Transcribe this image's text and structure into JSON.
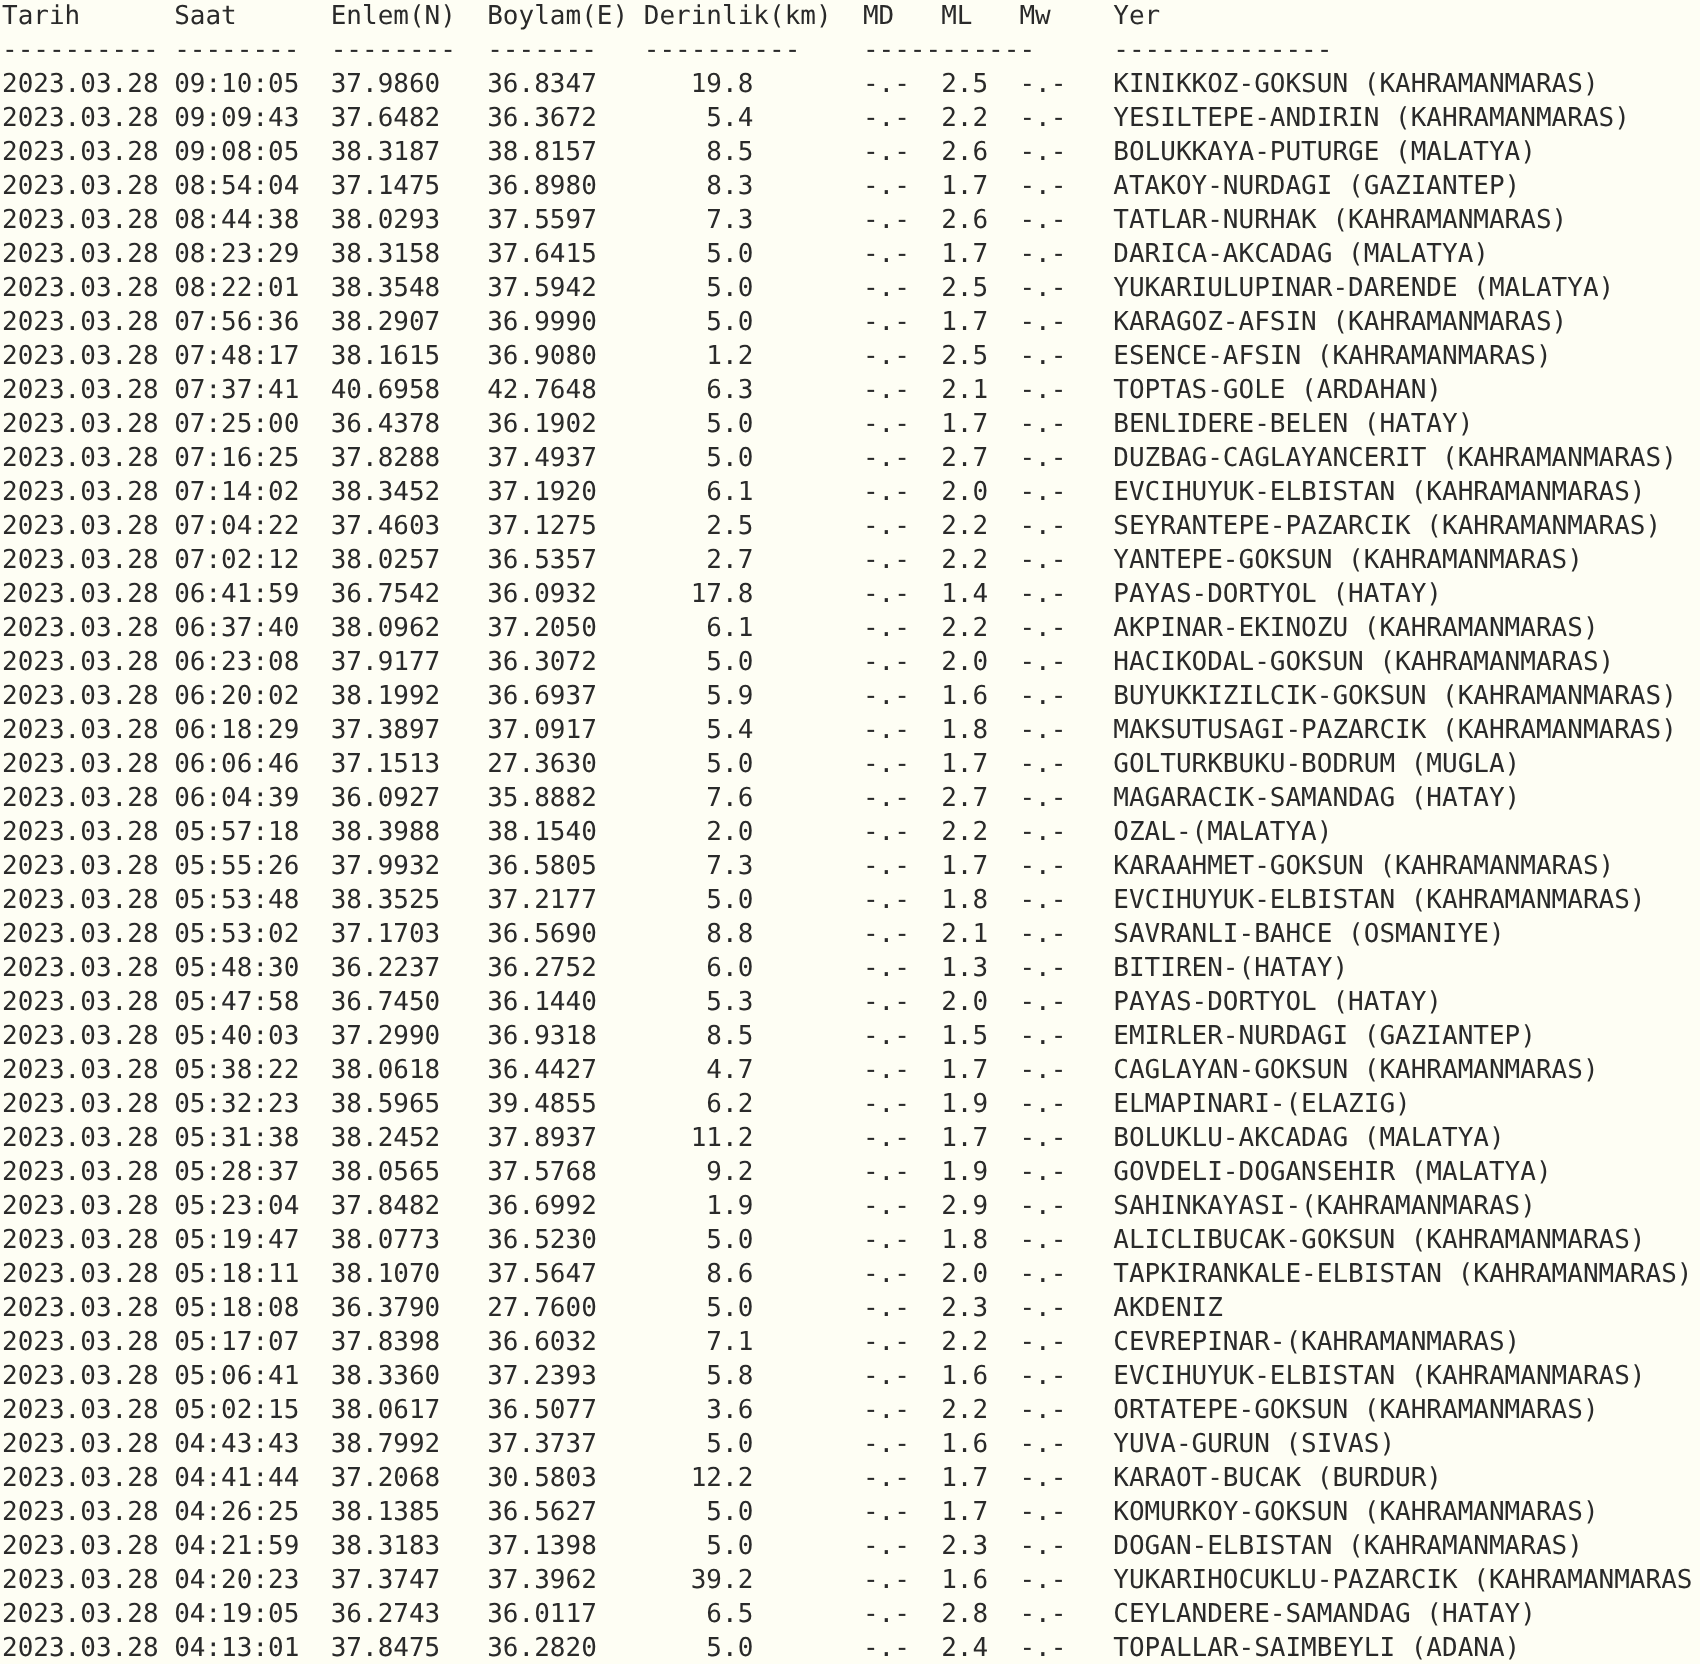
{
  "header": [
    "Tarih",
    "Saat",
    "Enlem(N)",
    "Boylam(E)",
    "Derinlik(km)",
    "MD",
    "ML",
    "Mw",
    "Yer"
  ],
  "rules": [
    "----------",
    "--------",
    "--------",
    "-------",
    "----------",
    "-----------",
    "--------------"
  ],
  "rows": [
    {
      "date": "2023.03.28",
      "time": "09:10:05",
      "lat": "37.9860",
      "lon": "36.8347",
      "depth": "19.8",
      "md": "-.-",
      "ml": "2.5",
      "mw": "-.-",
      "place": "KINIKKOZ-GOKSUN (KAHRAMANMARAS)"
    },
    {
      "date": "2023.03.28",
      "time": "09:09:43",
      "lat": "37.6482",
      "lon": "36.3672",
      "depth": "5.4",
      "md": "-.-",
      "ml": "2.2",
      "mw": "-.-",
      "place": "YESILTEPE-ANDIRIN (KAHRAMANMARAS)"
    },
    {
      "date": "2023.03.28",
      "time": "09:08:05",
      "lat": "38.3187",
      "lon": "38.8157",
      "depth": "8.5",
      "md": "-.-",
      "ml": "2.6",
      "mw": "-.-",
      "place": "BOLUKKAYA-PUTURGE (MALATYA)"
    },
    {
      "date": "2023.03.28",
      "time": "08:54:04",
      "lat": "37.1475",
      "lon": "36.8980",
      "depth": "8.3",
      "md": "-.-",
      "ml": "1.7",
      "mw": "-.-",
      "place": "ATAKOY-NURDAGI (GAZIANTEP)"
    },
    {
      "date": "2023.03.28",
      "time": "08:44:38",
      "lat": "38.0293",
      "lon": "37.5597",
      "depth": "7.3",
      "md": "-.-",
      "ml": "2.6",
      "mw": "-.-",
      "place": "TATLAR-NURHAK (KAHRAMANMARAS)"
    },
    {
      "date": "2023.03.28",
      "time": "08:23:29",
      "lat": "38.3158",
      "lon": "37.6415",
      "depth": "5.0",
      "md": "-.-",
      "ml": "1.7",
      "mw": "-.-",
      "place": "DARICA-AKCADAG (MALATYA)"
    },
    {
      "date": "2023.03.28",
      "time": "08:22:01",
      "lat": "38.3548",
      "lon": "37.5942",
      "depth": "5.0",
      "md": "-.-",
      "ml": "2.5",
      "mw": "-.-",
      "place": "YUKARIULUPINAR-DARENDE (MALATYA)"
    },
    {
      "date": "2023.03.28",
      "time": "07:56:36",
      "lat": "38.2907",
      "lon": "36.9990",
      "depth": "5.0",
      "md": "-.-",
      "ml": "1.7",
      "mw": "-.-",
      "place": "KARAGOZ-AFSIN (KAHRAMANMARAS)"
    },
    {
      "date": "2023.03.28",
      "time": "07:48:17",
      "lat": "38.1615",
      "lon": "36.9080",
      "depth": "1.2",
      "md": "-.-",
      "ml": "2.5",
      "mw": "-.-",
      "place": "ESENCE-AFSIN (KAHRAMANMARAS)"
    },
    {
      "date": "2023.03.28",
      "time": "07:37:41",
      "lat": "40.6958",
      "lon": "42.7648",
      "depth": "6.3",
      "md": "-.-",
      "ml": "2.1",
      "mw": "-.-",
      "place": "TOPTAS-GOLE (ARDAHAN)"
    },
    {
      "date": "2023.03.28",
      "time": "07:25:00",
      "lat": "36.4378",
      "lon": "36.1902",
      "depth": "5.0",
      "md": "-.-",
      "ml": "1.7",
      "mw": "-.-",
      "place": "BENLIDERE-BELEN (HATAY)"
    },
    {
      "date": "2023.03.28",
      "time": "07:16:25",
      "lat": "37.8288",
      "lon": "37.4937",
      "depth": "5.0",
      "md": "-.-",
      "ml": "2.7",
      "mw": "-.-",
      "place": "DUZBAG-CAGLAYANCERIT (KAHRAMANMARAS)"
    },
    {
      "date": "2023.03.28",
      "time": "07:14:02",
      "lat": "38.3452",
      "lon": "37.1920",
      "depth": "6.1",
      "md": "-.-",
      "ml": "2.0",
      "mw": "-.-",
      "place": "EVCIHUYUK-ELBISTAN (KAHRAMANMARAS)"
    },
    {
      "date": "2023.03.28",
      "time": "07:04:22",
      "lat": "37.4603",
      "lon": "37.1275",
      "depth": "2.5",
      "md": "-.-",
      "ml": "2.2",
      "mw": "-.-",
      "place": "SEYRANTEPE-PAZARCIK (KAHRAMANMARAS)"
    },
    {
      "date": "2023.03.28",
      "time": "07:02:12",
      "lat": "38.0257",
      "lon": "36.5357",
      "depth": "2.7",
      "md": "-.-",
      "ml": "2.2",
      "mw": "-.-",
      "place": "YANTEPE-GOKSUN (KAHRAMANMARAS)"
    },
    {
      "date": "2023.03.28",
      "time": "06:41:59",
      "lat": "36.7542",
      "lon": "36.0932",
      "depth": "17.8",
      "md": "-.-",
      "ml": "1.4",
      "mw": "-.-",
      "place": "PAYAS-DORTYOL (HATAY)"
    },
    {
      "date": "2023.03.28",
      "time": "06:37:40",
      "lat": "38.0962",
      "lon": "37.2050",
      "depth": "6.1",
      "md": "-.-",
      "ml": "2.2",
      "mw": "-.-",
      "place": "AKPINAR-EKINOZU (KAHRAMANMARAS)"
    },
    {
      "date": "2023.03.28",
      "time": "06:23:08",
      "lat": "37.9177",
      "lon": "36.3072",
      "depth": "5.0",
      "md": "-.-",
      "ml": "2.0",
      "mw": "-.-",
      "place": "HACIKODAL-GOKSUN (KAHRAMANMARAS)"
    },
    {
      "date": "2023.03.28",
      "time": "06:20:02",
      "lat": "38.1992",
      "lon": "36.6937",
      "depth": "5.9",
      "md": "-.-",
      "ml": "1.6",
      "mw": "-.-",
      "place": "BUYUKKIZILCIK-GOKSUN (KAHRAMANMARAS)"
    },
    {
      "date": "2023.03.28",
      "time": "06:18:29",
      "lat": "37.3897",
      "lon": "37.0917",
      "depth": "5.4",
      "md": "-.-",
      "ml": "1.8",
      "mw": "-.-",
      "place": "MAKSUTUSAGI-PAZARCIK (KAHRAMANMARAS)"
    },
    {
      "date": "2023.03.28",
      "time": "06:06:46",
      "lat": "37.1513",
      "lon": "27.3630",
      "depth": "5.0",
      "md": "-.-",
      "ml": "1.7",
      "mw": "-.-",
      "place": "GOLTURKBUKU-BODRUM (MUGLA)"
    },
    {
      "date": "2023.03.28",
      "time": "06:04:39",
      "lat": "36.0927",
      "lon": "35.8882",
      "depth": "7.6",
      "md": "-.-",
      "ml": "2.7",
      "mw": "-.-",
      "place": "MAGARACIK-SAMANDAG (HATAY)"
    },
    {
      "date": "2023.03.28",
      "time": "05:57:18",
      "lat": "38.3988",
      "lon": "38.1540",
      "depth": "2.0",
      "md": "-.-",
      "ml": "2.2",
      "mw": "-.-",
      "place": "OZAL-(MALATYA)"
    },
    {
      "date": "2023.03.28",
      "time": "05:55:26",
      "lat": "37.9932",
      "lon": "36.5805",
      "depth": "7.3",
      "md": "-.-",
      "ml": "1.7",
      "mw": "-.-",
      "place": "KARAAHMET-GOKSUN (KAHRAMANMARAS)"
    },
    {
      "date": "2023.03.28",
      "time": "05:53:48",
      "lat": "38.3525",
      "lon": "37.2177",
      "depth": "5.0",
      "md": "-.-",
      "ml": "1.8",
      "mw": "-.-",
      "place": "EVCIHUYUK-ELBISTAN (KAHRAMANMARAS)"
    },
    {
      "date": "2023.03.28",
      "time": "05:53:02",
      "lat": "37.1703",
      "lon": "36.5690",
      "depth": "8.8",
      "md": "-.-",
      "ml": "2.1",
      "mw": "-.-",
      "place": "SAVRANLI-BAHCE (OSMANIYE)"
    },
    {
      "date": "2023.03.28",
      "time": "05:48:30",
      "lat": "36.2237",
      "lon": "36.2752",
      "depth": "6.0",
      "md": "-.-",
      "ml": "1.3",
      "mw": "-.-",
      "place": "BITIREN-(HATAY)"
    },
    {
      "date": "2023.03.28",
      "time": "05:47:58",
      "lat": "36.7450",
      "lon": "36.1440",
      "depth": "5.3",
      "md": "-.-",
      "ml": "2.0",
      "mw": "-.-",
      "place": "PAYAS-DORTYOL (HATAY)"
    },
    {
      "date": "2023.03.28",
      "time": "05:40:03",
      "lat": "37.2990",
      "lon": "36.9318",
      "depth": "8.5",
      "md": "-.-",
      "ml": "1.5",
      "mw": "-.-",
      "place": "EMIRLER-NURDAGI (GAZIANTEP)"
    },
    {
      "date": "2023.03.28",
      "time": "05:38:22",
      "lat": "38.0618",
      "lon": "36.4427",
      "depth": "4.7",
      "md": "-.-",
      "ml": "1.7",
      "mw": "-.-",
      "place": "CAGLAYAN-GOKSUN (KAHRAMANMARAS)"
    },
    {
      "date": "2023.03.28",
      "time": "05:32:23",
      "lat": "38.5965",
      "lon": "39.4855",
      "depth": "6.2",
      "md": "-.-",
      "ml": "1.9",
      "mw": "-.-",
      "place": "ELMAPINARI-(ELAZIG)"
    },
    {
      "date": "2023.03.28",
      "time": "05:31:38",
      "lat": "38.2452",
      "lon": "37.8937",
      "depth": "11.2",
      "md": "-.-",
      "ml": "1.7",
      "mw": "-.-",
      "place": "BOLUKLU-AKCADAG (MALATYA)"
    },
    {
      "date": "2023.03.28",
      "time": "05:28:37",
      "lat": "38.0565",
      "lon": "37.5768",
      "depth": "9.2",
      "md": "-.-",
      "ml": "1.9",
      "mw": "-.-",
      "place": "GOVDELI-DOGANSEHIR (MALATYA)"
    },
    {
      "date": "2023.03.28",
      "time": "05:23:04",
      "lat": "37.8482",
      "lon": "36.6992",
      "depth": "1.9",
      "md": "-.-",
      "ml": "2.9",
      "mw": "-.-",
      "place": "SAHINKAYASI-(KAHRAMANMARAS)"
    },
    {
      "date": "2023.03.28",
      "time": "05:19:47",
      "lat": "38.0773",
      "lon": "36.5230",
      "depth": "5.0",
      "md": "-.-",
      "ml": "1.8",
      "mw": "-.-",
      "place": "ALICLIBUCAK-GOKSUN (KAHRAMANMARAS)"
    },
    {
      "date": "2023.03.28",
      "time": "05:18:11",
      "lat": "38.1070",
      "lon": "37.5647",
      "depth": "8.6",
      "md": "-.-",
      "ml": "2.0",
      "mw": "-.-",
      "place": "TAPKIRANKALE-ELBISTAN (KAHRAMANMARAS)"
    },
    {
      "date": "2023.03.28",
      "time": "05:18:08",
      "lat": "36.3790",
      "lon": "27.7600",
      "depth": "5.0",
      "md": "-.-",
      "ml": "2.3",
      "mw": "-.-",
      "place": "AKDENIZ"
    },
    {
      "date": "2023.03.28",
      "time": "05:17:07",
      "lat": "37.8398",
      "lon": "36.6032",
      "depth": "7.1",
      "md": "-.-",
      "ml": "2.2",
      "mw": "-.-",
      "place": "CEVREPINAR-(KAHRAMANMARAS)"
    },
    {
      "date": "2023.03.28",
      "time": "05:06:41",
      "lat": "38.3360",
      "lon": "37.2393",
      "depth": "5.8",
      "md": "-.-",
      "ml": "1.6",
      "mw": "-.-",
      "place": "EVCIHUYUK-ELBISTAN (KAHRAMANMARAS)"
    },
    {
      "date": "2023.03.28",
      "time": "05:02:15",
      "lat": "38.0617",
      "lon": "36.5077",
      "depth": "3.6",
      "md": "-.-",
      "ml": "2.2",
      "mw": "-.-",
      "place": "ORTATEPE-GOKSUN (KAHRAMANMARAS)"
    },
    {
      "date": "2023.03.28",
      "time": "04:43:43",
      "lat": "38.7992",
      "lon": "37.3737",
      "depth": "5.0",
      "md": "-.-",
      "ml": "1.6",
      "mw": "-.-",
      "place": "YUVA-GURUN (SIVAS)"
    },
    {
      "date": "2023.03.28",
      "time": "04:41:44",
      "lat": "37.2068",
      "lon": "30.5803",
      "depth": "12.2",
      "md": "-.-",
      "ml": "1.7",
      "mw": "-.-",
      "place": "KARAOT-BUCAK (BURDUR)"
    },
    {
      "date": "2023.03.28",
      "time": "04:26:25",
      "lat": "38.1385",
      "lon": "36.5627",
      "depth": "5.0",
      "md": "-.-",
      "ml": "1.7",
      "mw": "-.-",
      "place": "KOMURKOY-GOKSUN (KAHRAMANMARAS)"
    },
    {
      "date": "2023.03.28",
      "time": "04:21:59",
      "lat": "38.3183",
      "lon": "37.1398",
      "depth": "5.0",
      "md": "-.-",
      "ml": "2.3",
      "mw": "-.-",
      "place": "DOGAN-ELBISTAN (KAHRAMANMARAS)"
    },
    {
      "date": "2023.03.28",
      "time": "04:20:23",
      "lat": "37.3747",
      "lon": "37.3962",
      "depth": "39.2",
      "md": "-.-",
      "ml": "1.6",
      "mw": "-.-",
      "place": "YUKARIHOCUKLU-PAZARCIK (KAHRAMANMARAS"
    },
    {
      "date": "2023.03.28",
      "time": "04:19:05",
      "lat": "36.2743",
      "lon": "36.0117",
      "depth": "6.5",
      "md": "-.-",
      "ml": "2.8",
      "mw": "-.-",
      "place": "CEYLANDERE-SAMANDAG (HATAY)"
    },
    {
      "date": "2023.03.28",
      "time": "04:13:01",
      "lat": "37.8475",
      "lon": "36.2820",
      "depth": "5.0",
      "md": "-.-",
      "ml": "2.4",
      "mw": "-.-",
      "place": "TOPALLAR-SAIMBEYLI (ADANA)"
    }
  ]
}
